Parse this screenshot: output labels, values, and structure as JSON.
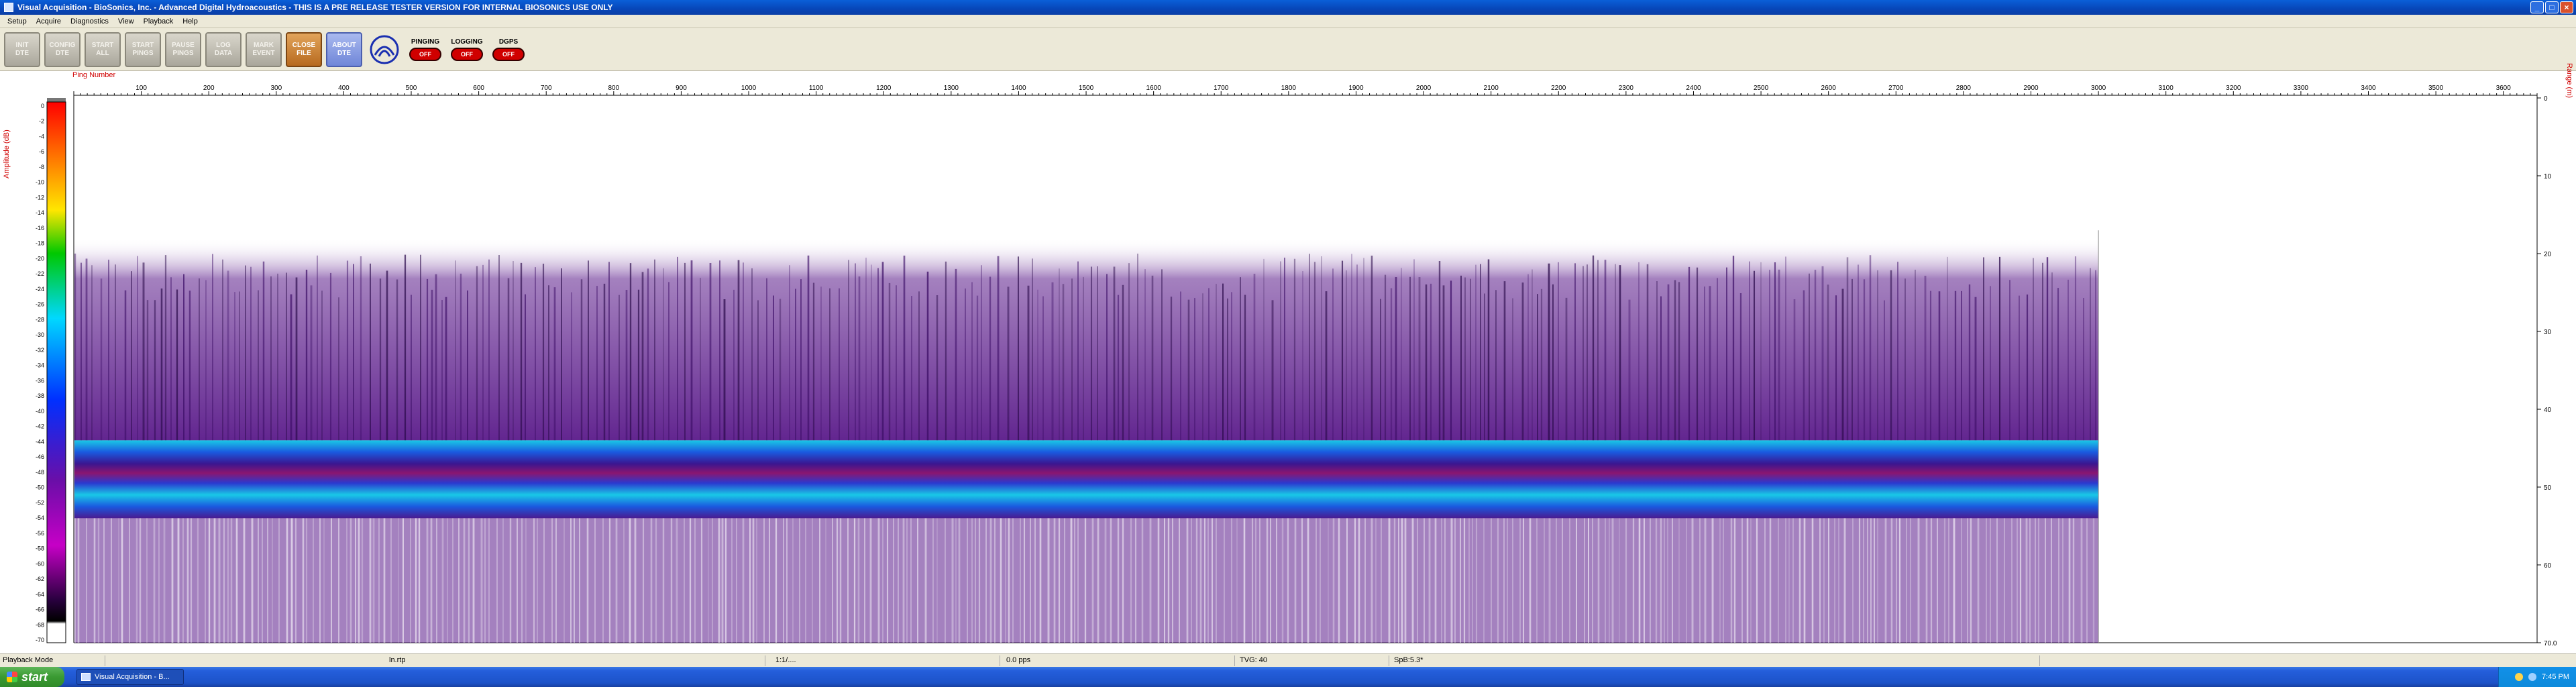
{
  "window": {
    "title": "Visual Acquisition  -  BioSonics, Inc.  -  Advanced Digital Hydroacoustics  -  THIS IS A PRE RELEASE TESTER VERSION FOR INTERNAL BIOSONICS USE ONLY",
    "minimize_glyph": "_",
    "maximize_glyph": "□",
    "close_glyph": "×"
  },
  "menu": [
    "Setup",
    "Acquire",
    "Diagnostics",
    "View",
    "Playback",
    "Help"
  ],
  "toolbar": {
    "buttons": [
      {
        "id": "init-dte",
        "label": "INIT\nDTE",
        "style": "gray"
      },
      {
        "id": "config-dte",
        "label": "CONFIG\nDTE",
        "style": "gray"
      },
      {
        "id": "start-all",
        "label": "START\nALL",
        "style": "gray"
      },
      {
        "id": "start-pings",
        "label": "START\nPINGS",
        "style": "gray"
      },
      {
        "id": "pause-pings",
        "label": "PAUSE\nPINGS",
        "style": "gray"
      },
      {
        "id": "log-data",
        "label": "LOG\nDATA",
        "style": "gray"
      },
      {
        "id": "mark-event",
        "label": "MARK\nEVENT",
        "style": "gray"
      },
      {
        "id": "close-file",
        "label": "CLOSE\nFILE",
        "style": "active"
      },
      {
        "id": "about-dte",
        "label": "ABOUT\nDTE",
        "style": "blue"
      }
    ],
    "indicators": [
      {
        "id": "pinging",
        "label": "PINGING",
        "state": "OFF"
      },
      {
        "id": "logging",
        "label": "LOGGING",
        "state": "OFF"
      },
      {
        "id": "dgps",
        "label": "DGPS",
        "state": "OFF"
      }
    ]
  },
  "plot": {
    "amplitude_axis_label": "Amplitude (dB)",
    "range_axis_label": "Range (m)",
    "ping_axis_label": "Ping Number",
    "ping_ticks": [
      "100",
      "200",
      "300",
      "400",
      "500",
      "600",
      "700",
      "800",
      "900",
      "1000",
      "1100",
      "1200",
      "1300",
      "1400",
      "1500",
      "1600",
      "1700",
      "1800",
      "1900",
      "2000",
      "2100",
      "2200",
      "2300",
      "2400",
      "2500",
      "2600",
      "2700",
      "2800",
      "2900",
      "3000",
      "3100",
      "3200",
      "3300",
      "3400",
      "3500",
      "3600"
    ],
    "amplitude_ticks": [
      "0",
      "-2",
      "-4",
      "-6",
      "-8",
      "-10",
      "-12",
      "-14",
      "-16",
      "-18",
      "-20",
      "-22",
      "-24",
      "-26",
      "-28",
      "-30",
      "-32",
      "-34",
      "-36",
      "-38",
      "-40",
      "-42",
      "-44",
      "-46",
      "-48",
      "-50",
      "-52",
      "-54",
      "-56",
      "-58",
      "-60",
      "-62",
      "-64",
      "-66",
      "-68",
      "-70"
    ],
    "range_ticks": [
      "0",
      "10",
      "20",
      "30",
      "40",
      "50",
      "60",
      "70.0"
    ],
    "ping_max_recorded": 3000,
    "ping_axis_max": 3650,
    "range_max": 70,
    "colors": {
      "noise_purple": "#5a1a8a",
      "band_cyan": "#19c8e6",
      "band_blue": "#1a5ae0",
      "axis_red": "#d00000"
    }
  },
  "status": {
    "mode": "Playback Mode",
    "file": "ln.rtp",
    "time": "1:1/....",
    "ping_rate": "0.0 pps",
    "tvg": "TVG: 40",
    "spl": "SpB:5.3*"
  },
  "taskbar": {
    "start_label": "start",
    "task_label": "Visual Acquisition  -  B...",
    "clock": "7:45 PM"
  }
}
